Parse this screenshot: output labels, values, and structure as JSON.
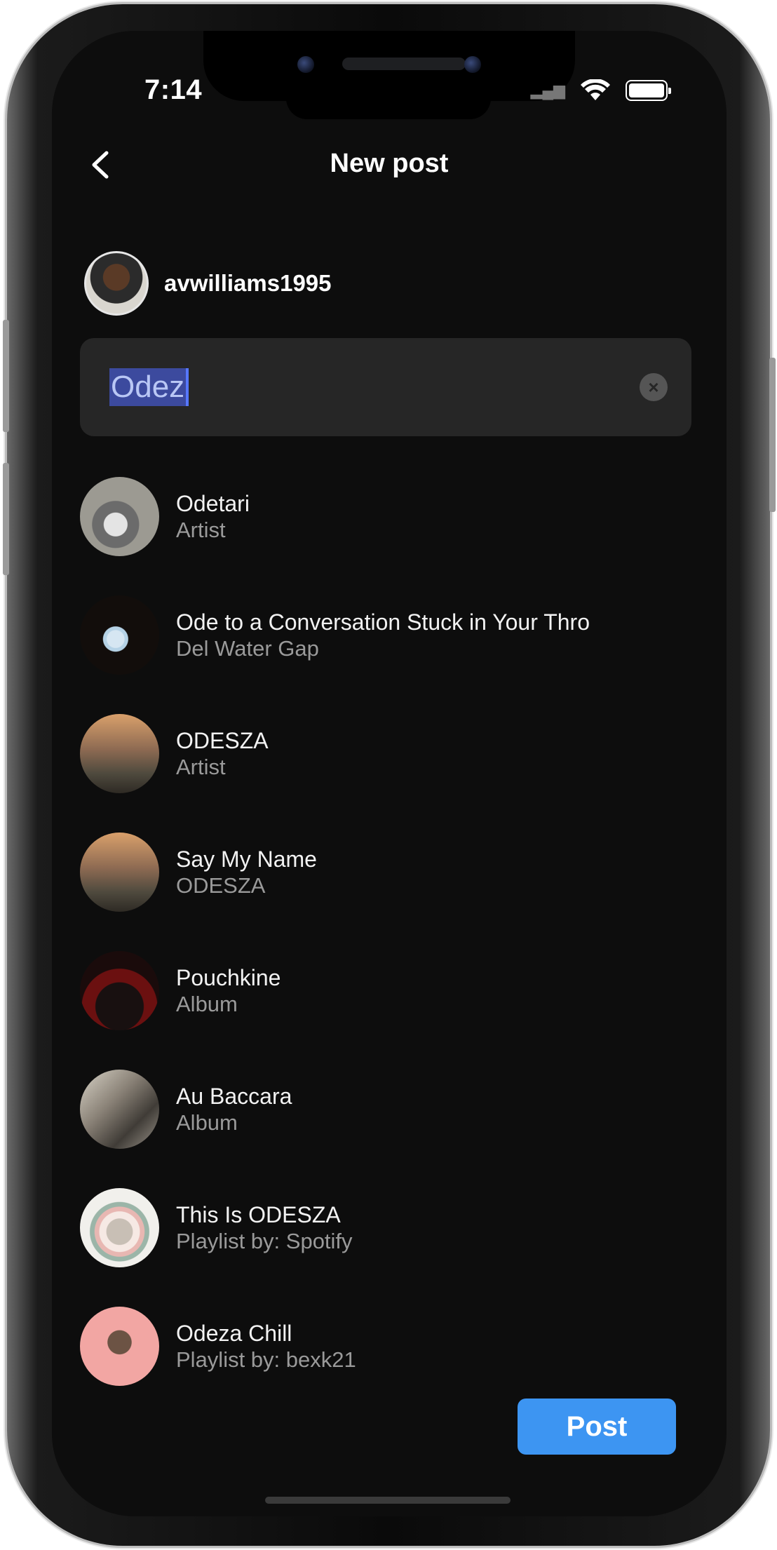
{
  "status_bar": {
    "time": "7:14"
  },
  "header": {
    "title": "New post"
  },
  "user": {
    "username": "avwilliams1995"
  },
  "search": {
    "value": "Odez"
  },
  "results": [
    {
      "title": "Odetari",
      "subtitle": "Artist",
      "art": "art-odetari"
    },
    {
      "title": "Ode to a Conversation Stuck in Your Thro",
      "subtitle": "Del Water Gap",
      "art": "art-ode"
    },
    {
      "title": "ODESZA",
      "subtitle": "Artist",
      "art": "art-odesza"
    },
    {
      "title": "Say My Name",
      "subtitle": "ODESZA",
      "art": "art-odesza"
    },
    {
      "title": "Pouchkine",
      "subtitle": "Album",
      "art": "art-pouchkine"
    },
    {
      "title": "Au Baccara",
      "subtitle": "Album",
      "art": "art-baccara"
    },
    {
      "title": "This Is ODESZA",
      "subtitle": "Playlist by: Spotify",
      "art": "art-thisis"
    },
    {
      "title": "Odeza Chill",
      "subtitle": "Playlist by: bexk21",
      "art": "art-chill"
    }
  ],
  "footer": {
    "post_label": "Post"
  },
  "colors": {
    "accent": "#3d95f2",
    "background": "#0d0d0d",
    "field": "#262626"
  }
}
